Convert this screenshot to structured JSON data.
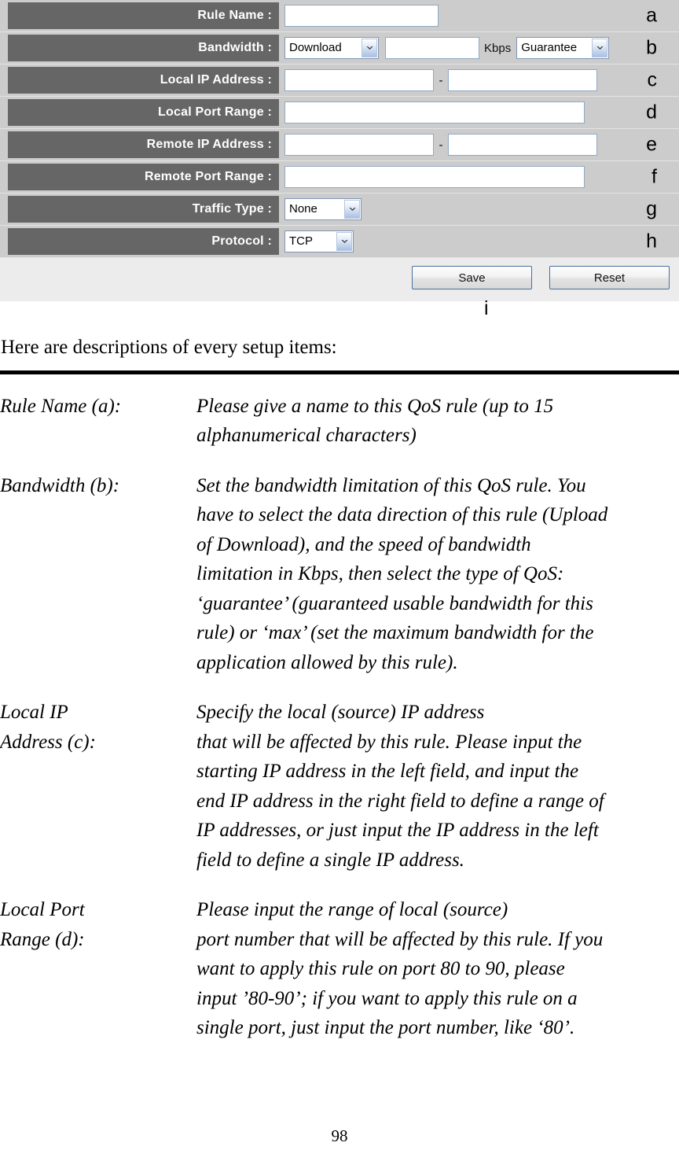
{
  "form": {
    "rows": [
      {
        "label": "Rule Name :",
        "marker": "a",
        "type": "text"
      },
      {
        "label": "Bandwidth :",
        "marker": "b",
        "type": "bandwidth",
        "direction_value": "Download",
        "unit": "Kbps",
        "qos_value": "Guarantee"
      },
      {
        "label": "Local IP Address :",
        "marker": "c",
        "type": "range",
        "separator": "-"
      },
      {
        "label": "Local Port Range :",
        "marker": "d",
        "type": "wide-text"
      },
      {
        "label": "Remote IP Address :",
        "marker": "e",
        "type": "range",
        "separator": "-"
      },
      {
        "label": "Remote Port Range :",
        "marker": "f",
        "type": "wide-text"
      },
      {
        "label": "Traffic Type :",
        "marker": "g",
        "type": "select",
        "value": "None"
      },
      {
        "label": "Protocol :",
        "marker": "h",
        "type": "select",
        "value": "TCP"
      }
    ],
    "buttons": {
      "save": "Save",
      "reset": "Reset"
    },
    "footer_marker": "i",
    "colors": {
      "label_background": "#666666",
      "row_background": "#cccccc",
      "footer_background": "#ececec",
      "field_border": "#8fa9c4",
      "button_border": "#4a6f9e"
    }
  },
  "document": {
    "heading": "Here are descriptions of every setup items:",
    "definitions": [
      {
        "term": [
          "Rule Name (a):"
        ],
        "description": [
          "Please give a name to this QoS rule (up to 15",
          "alphanumerical characters)"
        ]
      },
      {
        "term": [
          "Bandwidth (b):"
        ],
        "description": [
          "Set the bandwidth limitation of this QoS rule. You",
          "have to select the data direction of this rule (Upload",
          "of Download), and the speed of bandwidth",
          "limitation in Kbps, then select the type of QoS:",
          "‘guarantee’ (guaranteed usable bandwidth for this",
          "rule) or ‘max’ (set the maximum bandwidth for the",
          "application allowed by this rule)."
        ]
      },
      {
        "term": [
          "Local IP",
          "Address (c):"
        ],
        "description": [
          "Specify the local (source) IP address",
          "that will be affected by this rule. Please input the",
          "starting IP address in the left field, and input the",
          "end IP address in the right field to define a range of",
          "IP addresses, or just input the IP address in the left",
          "field to define a single IP address."
        ]
      },
      {
        "term": [
          "Local Port",
          "Range (d):"
        ],
        "description": [
          "Please input the range of local (source)",
          "port number that will be affected by this rule. If you",
          "want to apply this rule on port 80 to 90, please",
          "input ’80-90’; if you want to apply this rule on a",
          "single port, just input the port number, like ‘80’."
        ]
      }
    ],
    "page_number": "98"
  }
}
